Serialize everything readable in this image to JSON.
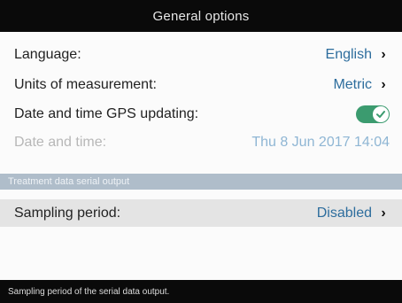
{
  "title": "General options",
  "settings": {
    "language": {
      "label": "Language:",
      "value": "English"
    },
    "units": {
      "label": "Units of measurement:",
      "value": "Metric"
    },
    "gps_update": {
      "label": "Date and time GPS updating:",
      "enabled": true
    },
    "datetime": {
      "label": "Date and time:",
      "value": "Thu 8 Jun 2017 14:04"
    }
  },
  "section": {
    "header": "Treatment data serial output",
    "sampling": {
      "label": "Sampling period:",
      "value": "Disabled"
    }
  },
  "status": "Sampling period of the serial data output.",
  "colors": {
    "accent": "#2d6d9d",
    "toggle_on": "#3b9b6f",
    "section_header": "#afbdca"
  }
}
